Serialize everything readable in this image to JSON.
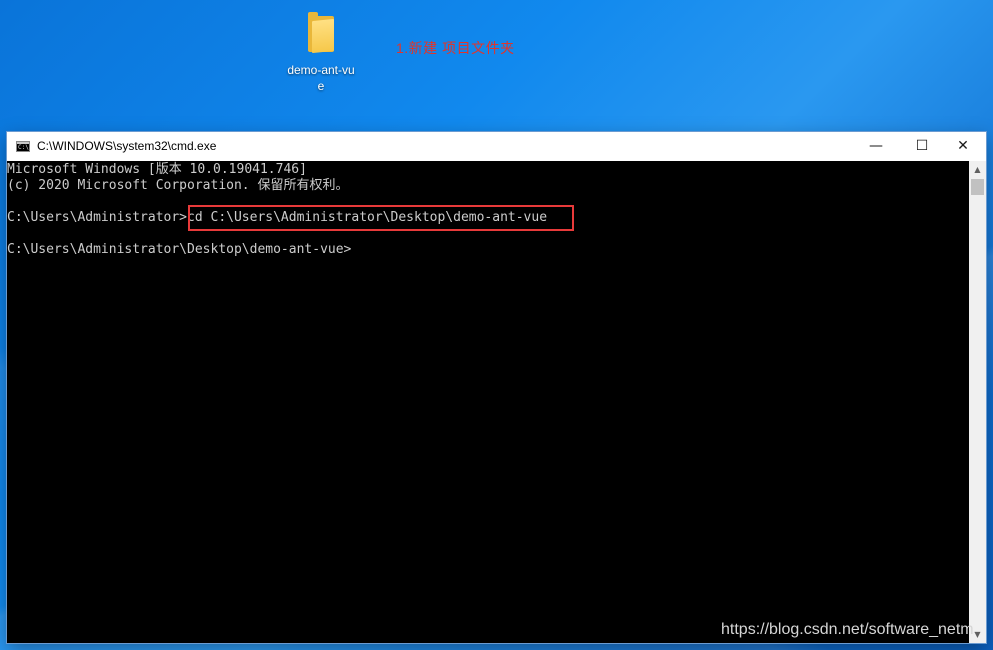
{
  "desktop": {
    "folder": {
      "icon": "folder-icon",
      "label": "demo-ant-vue"
    },
    "annotation": "1.新建 项目文件夹",
    "watermark": "https://blog.csdn.net/software_netm"
  },
  "window": {
    "title": "C:\\WINDOWS\\system32\\cmd.exe",
    "app_icon": "cmd-app-icon",
    "app_icon_text": "C:\\",
    "controls": {
      "minimize": "—",
      "maximize": "☐",
      "close": "✕"
    }
  },
  "console": {
    "lines": [
      "Microsoft Windows [版本 10.0.19041.746]",
      "(c) 2020 Microsoft Corporation. 保留所有权利。",
      "",
      "C:\\Users\\Administrator>cd C:\\Users\\Administrator\\Desktop\\demo-ant-vue",
      "",
      "C:\\Users\\Administrator\\Desktop\\demo-ant-vue>"
    ],
    "highlight_color": "#e83a3a"
  },
  "scrollbar": {
    "up": "▲",
    "down": "▼"
  },
  "colors": {
    "console_bg": "#000000",
    "console_text": "#cccccc",
    "annotation": "#e0352b",
    "desktop": "#1189ee"
  }
}
